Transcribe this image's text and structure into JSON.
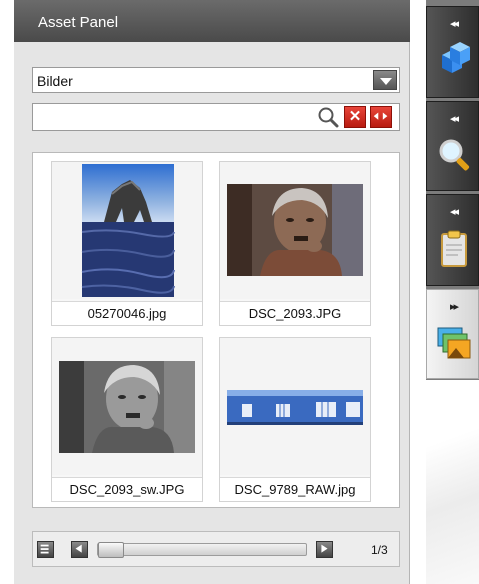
{
  "panel": {
    "title": "Asset Panel"
  },
  "category": {
    "selected": "Bilder"
  },
  "search": {
    "value": "",
    "placeholder": ""
  },
  "thumbnails": [
    {
      "caption": "05270046.jpg"
    },
    {
      "caption": "DSC_2093.JPG"
    },
    {
      "caption": "DSC_2093_sw.JPG"
    },
    {
      "caption": "DSC_9789_RAW.jpg"
    }
  ],
  "pager": {
    "page": "1/3",
    "scroll_position": 0
  },
  "side_tabs": [
    {
      "id": "assets",
      "arrow": "◂◂",
      "icon": "cubes-icon"
    },
    {
      "id": "search",
      "arrow": "◂◂",
      "icon": "magnifier-icon"
    },
    {
      "id": "clipboard",
      "arrow": "◂◂",
      "icon": "clipboard-icon"
    },
    {
      "id": "gallery",
      "arrow": "▸▸",
      "icon": "images-icon",
      "active": true
    }
  ],
  "colors": {
    "header": "#555555",
    "tab_dark": "#3a3a3a",
    "accent_red": "#d2291d",
    "panel_bg": "#e5e5e5"
  }
}
